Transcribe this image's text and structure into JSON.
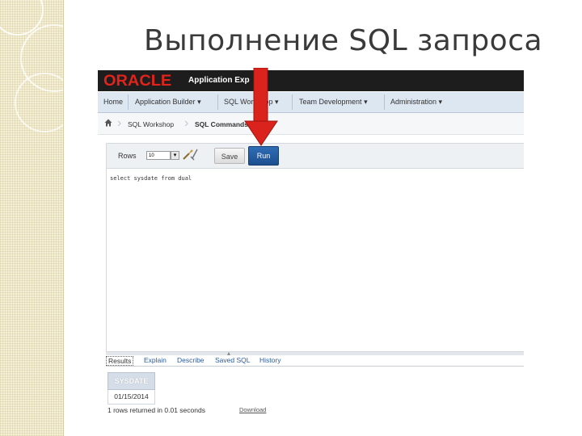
{
  "slide": {
    "title": "Выполнение SQL запроса"
  },
  "header": {
    "logo": "ORACLE",
    "app_name": "Application Exp"
  },
  "nav": {
    "items": [
      "Home",
      "Application Builder",
      "SQL Workshop",
      "Team Development",
      "Administration"
    ],
    "dropdown_glyph": "▾"
  },
  "breadcrumb": {
    "items": [
      "SQL Workshop",
      "SQL Commands"
    ]
  },
  "toolbar": {
    "rows_label": "Rows",
    "rows_value": "10",
    "save_label": "Save",
    "run_label": "Run"
  },
  "editor": {
    "sql": "select sysdate from dual"
  },
  "result_tabs": [
    "Results",
    "Explain",
    "Describe",
    "Saved SQL",
    "History"
  ],
  "results": {
    "columns": [
      "SYSDATE"
    ],
    "rows": [
      [
        "01/15/2014"
      ]
    ],
    "status": "1 rows returned in 0.01 seconds",
    "download_label": "Download"
  },
  "colors": {
    "oracle_red": "#e0241c",
    "nav_bg": "#dde7f2",
    "run_button": "#1f5598",
    "arrow_red": "#d9231c"
  }
}
